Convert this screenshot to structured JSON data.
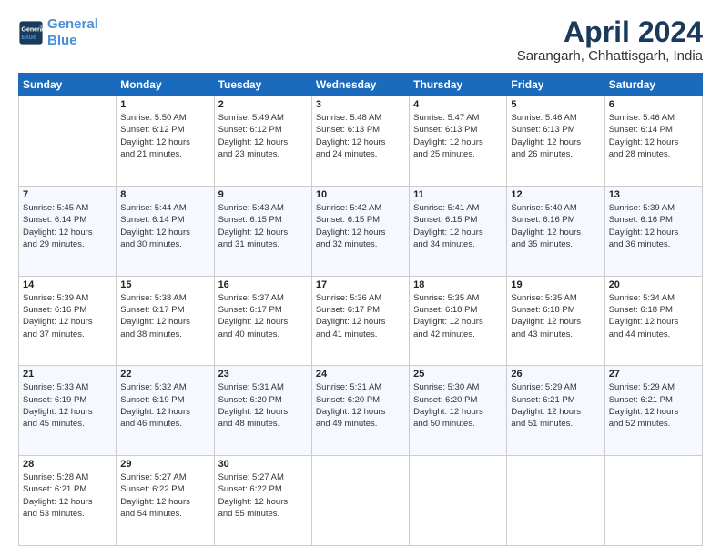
{
  "logo": {
    "line1": "General",
    "line2": "Blue"
  },
  "title": "April 2024",
  "location": "Sarangarh, Chhattisgarh, India",
  "days_header": [
    "Sunday",
    "Monday",
    "Tuesday",
    "Wednesday",
    "Thursday",
    "Friday",
    "Saturday"
  ],
  "weeks": [
    [
      {
        "day": "",
        "info": ""
      },
      {
        "day": "1",
        "info": "Sunrise: 5:50 AM\nSunset: 6:12 PM\nDaylight: 12 hours\nand 21 minutes."
      },
      {
        "day": "2",
        "info": "Sunrise: 5:49 AM\nSunset: 6:12 PM\nDaylight: 12 hours\nand 23 minutes."
      },
      {
        "day": "3",
        "info": "Sunrise: 5:48 AM\nSunset: 6:13 PM\nDaylight: 12 hours\nand 24 minutes."
      },
      {
        "day": "4",
        "info": "Sunrise: 5:47 AM\nSunset: 6:13 PM\nDaylight: 12 hours\nand 25 minutes."
      },
      {
        "day": "5",
        "info": "Sunrise: 5:46 AM\nSunset: 6:13 PM\nDaylight: 12 hours\nand 26 minutes."
      },
      {
        "day": "6",
        "info": "Sunrise: 5:46 AM\nSunset: 6:14 PM\nDaylight: 12 hours\nand 28 minutes."
      }
    ],
    [
      {
        "day": "7",
        "info": "Sunrise: 5:45 AM\nSunset: 6:14 PM\nDaylight: 12 hours\nand 29 minutes."
      },
      {
        "day": "8",
        "info": "Sunrise: 5:44 AM\nSunset: 6:14 PM\nDaylight: 12 hours\nand 30 minutes."
      },
      {
        "day": "9",
        "info": "Sunrise: 5:43 AM\nSunset: 6:15 PM\nDaylight: 12 hours\nand 31 minutes."
      },
      {
        "day": "10",
        "info": "Sunrise: 5:42 AM\nSunset: 6:15 PM\nDaylight: 12 hours\nand 32 minutes."
      },
      {
        "day": "11",
        "info": "Sunrise: 5:41 AM\nSunset: 6:15 PM\nDaylight: 12 hours\nand 34 minutes."
      },
      {
        "day": "12",
        "info": "Sunrise: 5:40 AM\nSunset: 6:16 PM\nDaylight: 12 hours\nand 35 minutes."
      },
      {
        "day": "13",
        "info": "Sunrise: 5:39 AM\nSunset: 6:16 PM\nDaylight: 12 hours\nand 36 minutes."
      }
    ],
    [
      {
        "day": "14",
        "info": "Sunrise: 5:39 AM\nSunset: 6:16 PM\nDaylight: 12 hours\nand 37 minutes."
      },
      {
        "day": "15",
        "info": "Sunrise: 5:38 AM\nSunset: 6:17 PM\nDaylight: 12 hours\nand 38 minutes."
      },
      {
        "day": "16",
        "info": "Sunrise: 5:37 AM\nSunset: 6:17 PM\nDaylight: 12 hours\nand 40 minutes."
      },
      {
        "day": "17",
        "info": "Sunrise: 5:36 AM\nSunset: 6:17 PM\nDaylight: 12 hours\nand 41 minutes."
      },
      {
        "day": "18",
        "info": "Sunrise: 5:35 AM\nSunset: 6:18 PM\nDaylight: 12 hours\nand 42 minutes."
      },
      {
        "day": "19",
        "info": "Sunrise: 5:35 AM\nSunset: 6:18 PM\nDaylight: 12 hours\nand 43 minutes."
      },
      {
        "day": "20",
        "info": "Sunrise: 5:34 AM\nSunset: 6:18 PM\nDaylight: 12 hours\nand 44 minutes."
      }
    ],
    [
      {
        "day": "21",
        "info": "Sunrise: 5:33 AM\nSunset: 6:19 PM\nDaylight: 12 hours\nand 45 minutes."
      },
      {
        "day": "22",
        "info": "Sunrise: 5:32 AM\nSunset: 6:19 PM\nDaylight: 12 hours\nand 46 minutes."
      },
      {
        "day": "23",
        "info": "Sunrise: 5:31 AM\nSunset: 6:20 PM\nDaylight: 12 hours\nand 48 minutes."
      },
      {
        "day": "24",
        "info": "Sunrise: 5:31 AM\nSunset: 6:20 PM\nDaylight: 12 hours\nand 49 minutes."
      },
      {
        "day": "25",
        "info": "Sunrise: 5:30 AM\nSunset: 6:20 PM\nDaylight: 12 hours\nand 50 minutes."
      },
      {
        "day": "26",
        "info": "Sunrise: 5:29 AM\nSunset: 6:21 PM\nDaylight: 12 hours\nand 51 minutes."
      },
      {
        "day": "27",
        "info": "Sunrise: 5:29 AM\nSunset: 6:21 PM\nDaylight: 12 hours\nand 52 minutes."
      }
    ],
    [
      {
        "day": "28",
        "info": "Sunrise: 5:28 AM\nSunset: 6:21 PM\nDaylight: 12 hours\nand 53 minutes."
      },
      {
        "day": "29",
        "info": "Sunrise: 5:27 AM\nSunset: 6:22 PM\nDaylight: 12 hours\nand 54 minutes."
      },
      {
        "day": "30",
        "info": "Sunrise: 5:27 AM\nSunset: 6:22 PM\nDaylight: 12 hours\nand 55 minutes."
      },
      {
        "day": "",
        "info": ""
      },
      {
        "day": "",
        "info": ""
      },
      {
        "day": "",
        "info": ""
      },
      {
        "day": "",
        "info": ""
      }
    ]
  ]
}
